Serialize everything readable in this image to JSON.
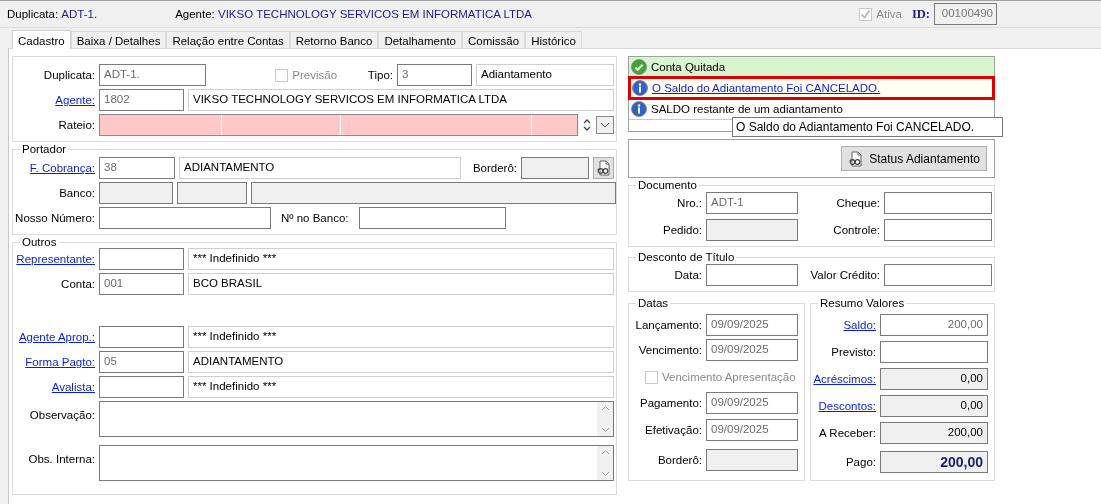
{
  "header": {
    "duplicata": {
      "label": "Duplicata:",
      "value": "ADT-1."
    },
    "agente": {
      "label": "Agente:",
      "value": "VIKSO TECHNOLOGY SERVICOS EM INFORMATICA LTDA"
    },
    "ativa": {
      "label": "Ativa",
      "checked": true,
      "disabled": true
    },
    "id": {
      "label": "ID:",
      "value": "00100490"
    }
  },
  "tabs": [
    {
      "label": "Cadastro",
      "selected": true
    },
    {
      "label": "Baixa / Detalhes",
      "selected": false
    },
    {
      "label": "Relação entre Contas",
      "selected": false
    },
    {
      "label": "Retorno Banco",
      "selected": false
    },
    {
      "label": "Detalhamento",
      "selected": false
    },
    {
      "label": "Comissão",
      "selected": false
    },
    {
      "label": "Histórico",
      "selected": false
    }
  ],
  "form": {
    "duplicata": {
      "label": "Duplicata:",
      "link": false,
      "field": {
        "value": "ADT-1.",
        "readonly": true
      }
    },
    "previsao": {
      "label": "Previsão",
      "checked": false,
      "disabled": true
    },
    "tipo": {
      "label": "Tipo:",
      "code": {
        "value": "3",
        "readonly": true
      },
      "description": {
        "value": "Adiantamento"
      }
    },
    "agente": {
      "label": "Agente:",
      "link": true,
      "code": {
        "value": "1802",
        "readonly": true
      },
      "description": {
        "value": "VIKSO TECHNOLOGY SERVICOS EM INFORMATICA LTDA"
      }
    },
    "rateio": {
      "label": "Rateio:"
    },
    "portador": {
      "title": "Portador",
      "f_cobranca": {
        "label": "F. Cobrança:",
        "link": true,
        "code": {
          "value": "38",
          "readonly": true
        },
        "description": {
          "value": "ADIANTAMENTO"
        }
      },
      "bordero": {
        "label": "Borderô:",
        "field": {
          "disabled": true
        }
      },
      "banco": {
        "label": "Banco:",
        "fields": [
          {
            "disabled": true
          },
          {
            "disabled": true
          },
          {
            "disabled": true
          }
        ]
      },
      "nosso_numero": {
        "label": "Nosso Número:",
        "field": {
          "disabled": false
        }
      },
      "no_banco": {
        "label": "Nº no Banco:",
        "field": {
          "disabled": false
        }
      }
    },
    "outros": {
      "title": "Outros",
      "rows": [
        {
          "label": "Representante:",
          "link": true,
          "code": {
            "disabled": false
          },
          "description": {
            "value": "*** Indefinido ***"
          }
        },
        {
          "label": "Conta:",
          "link": false,
          "code": {
            "value": "001",
            "readonly": true
          },
          "description": {
            "value": "BCO BRASIL"
          }
        },
        {
          "label": "Agente Aprop.:",
          "link": true,
          "code": {
            "disabled": false
          },
          "description": {
            "value": "*** Indefinido ***"
          }
        },
        {
          "label": "Forma Pagto:",
          "link": true,
          "code": {
            "value": "05",
            "readonly": true
          },
          "description": {
            "value": "ADIANTAMENTO"
          }
        },
        {
          "label": "Avalista:",
          "link": true,
          "code": {
            "disabled": false
          },
          "description": {
            "value": "*** Indefinido ***"
          }
        }
      ],
      "notes": [
        {
          "label": "Observação:"
        },
        {
          "label": "Obs. Interna:"
        }
      ]
    }
  },
  "status": {
    "messages": [
      {
        "kind": "success",
        "text": "Conta Quitada",
        "link": false,
        "focused": false
      },
      {
        "kind": "info",
        "text": "O Saldo do Adiantamento Foi CANCELADO.",
        "link": true,
        "focused": true
      },
      {
        "kind": "info",
        "text": "SALDO restante de um adiantamento",
        "link": false,
        "focused": false
      }
    ],
    "tooltip": "O Saldo do Adiantamento Foi CANCELADO.",
    "button": "Status Adiantamento"
  },
  "documento": {
    "title": "Documento",
    "fields": [
      {
        "label": "Nro.:",
        "value": "ADT-1",
        "readonly": true,
        "disabled": false
      },
      {
        "label": "Cheque:",
        "disabled": false
      },
      {
        "label": "Pedido:",
        "disabled": true
      },
      {
        "label": "Controle:",
        "disabled": false
      }
    ]
  },
  "desconto": {
    "title": "Desconto de Título",
    "fields": [
      {
        "label": "Data:",
        "disabled": false
      },
      {
        "label": "Valor Crédito:",
        "disabled": false
      }
    ]
  },
  "datas": {
    "title": "Datas",
    "rows": [
      {
        "kind": "field",
        "label": "Lançamento:",
        "value": "09/09/2025",
        "readonly": true
      },
      {
        "kind": "field",
        "label": "Vencimento:",
        "value": "09/09/2025",
        "readonly": true
      },
      {
        "kind": "checkbox",
        "label": "Vencimento Apresentação",
        "checked": false,
        "disabled": true
      },
      {
        "kind": "field",
        "label": "Pagamento:",
        "value": "09/09/2025",
        "readonly": true
      },
      {
        "kind": "field",
        "label": "Efetivação:",
        "value": "09/09/2025",
        "readonly": true
      },
      {
        "kind": "field",
        "label": "Borderô:",
        "disabled": true
      }
    ]
  },
  "resumo": {
    "title": "Resumo Valores",
    "rows": [
      {
        "label": "Saldo:",
        "link": true,
        "value": "200,00",
        "readonly": true,
        "disabled": false
      },
      {
        "label": "Previsto:",
        "link": false,
        "disabled": false
      },
      {
        "label": "Acréscimos:",
        "link": true,
        "value": "0,00",
        "disabled": true
      },
      {
        "label": "Descontos:",
        "link": true,
        "value": "0,00",
        "disabled": true
      },
      {
        "label": "A Receber:",
        "link": false,
        "value": "200,00",
        "disabled": true
      },
      {
        "label": "Pago:",
        "link": false,
        "value": "200,00",
        "disabled": true,
        "emphasis": true
      }
    ]
  }
}
